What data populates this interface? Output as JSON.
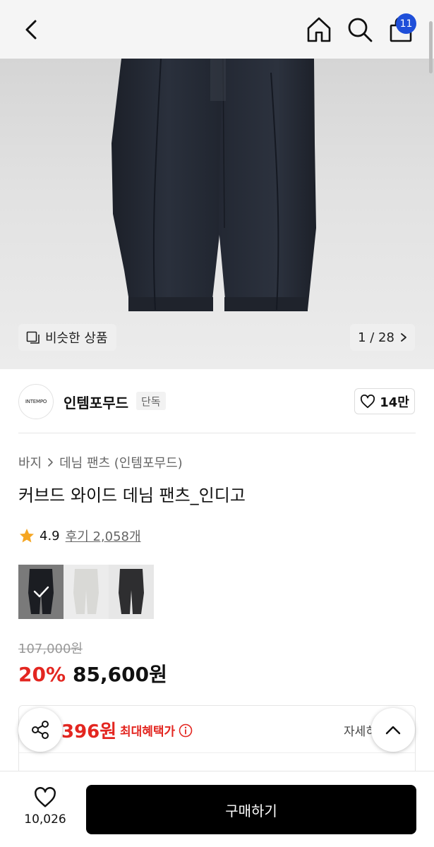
{
  "header": {
    "cart_count": "11",
    "icons": [
      "back-icon",
      "home-icon",
      "search-icon",
      "cart-icon"
    ]
  },
  "gallery": {
    "similar_label": "비슷한 상품",
    "current": 1,
    "total": 28,
    "pager_text": "1 / 28"
  },
  "brand": {
    "logo_text": "INTEMPO",
    "name": "인템포무드",
    "tag": "단독",
    "likes": "14만"
  },
  "breadcrumb": {
    "category": "바지",
    "subcategory": "데님 팬츠 (인템포무드)"
  },
  "product": {
    "title": "커브드 와이드 데님 팬츠_인디고",
    "rating": "4.9",
    "review_text": "후기 2,058개",
    "swatch_colors": [
      "#1b1d22",
      "#e9e9e6",
      "#2e2e30"
    ],
    "original_price": "107,000원",
    "discount": "20%",
    "price": "85,600원"
  },
  "benefit": {
    "price": "396원",
    "label": "최대혜택가",
    "more": "자세히"
  },
  "bottom": {
    "wish_count": "10,026",
    "buy_label": "구매하기"
  },
  "colors": {
    "accent_red": "#e32620",
    "badge_blue": "#1f4fd9",
    "buy_button": "#000000",
    "star": "#f5a623"
  }
}
